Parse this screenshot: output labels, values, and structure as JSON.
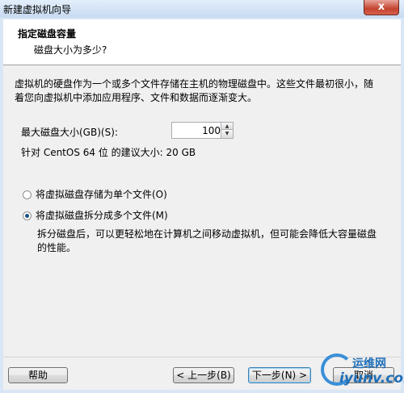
{
  "window": {
    "title": "新建虚拟机向导",
    "close_glyph": "x"
  },
  "header": {
    "title": "指定磁盘容量",
    "subtitle": "磁盘大小为多少?"
  },
  "description": "虚拟机的硬盘作为一个或多个文件存储在主机的物理磁盘中。这些文件最初很小，随着您向虚拟机中添加应用程序、文件和数据而逐渐变大。",
  "disk_size": {
    "label": "最大磁盘大小(GB)(S):",
    "value": "100",
    "up_glyph": "▲",
    "down_glyph": "▼"
  },
  "recommendation": "针对 CentOS 64 位 的建议大小: 20 GB",
  "storage_options": [
    {
      "label": "将虚拟磁盘存储为单个文件(O)",
      "selected": false
    },
    {
      "label": "将虚拟磁盘拆分成多个文件(M)",
      "selected": true
    }
  ],
  "split_description": "拆分磁盘后，可以更轻松地在计算机之间移动虚拟机，但可能会降低大容量磁盘的性能。",
  "buttons": {
    "help": "帮助",
    "back": "< 上一步(B)",
    "next": "下一步(N) >",
    "cancel": "取消"
  },
  "watermark": {
    "top": "运维网",
    "bottom": "iyunv.com"
  }
}
